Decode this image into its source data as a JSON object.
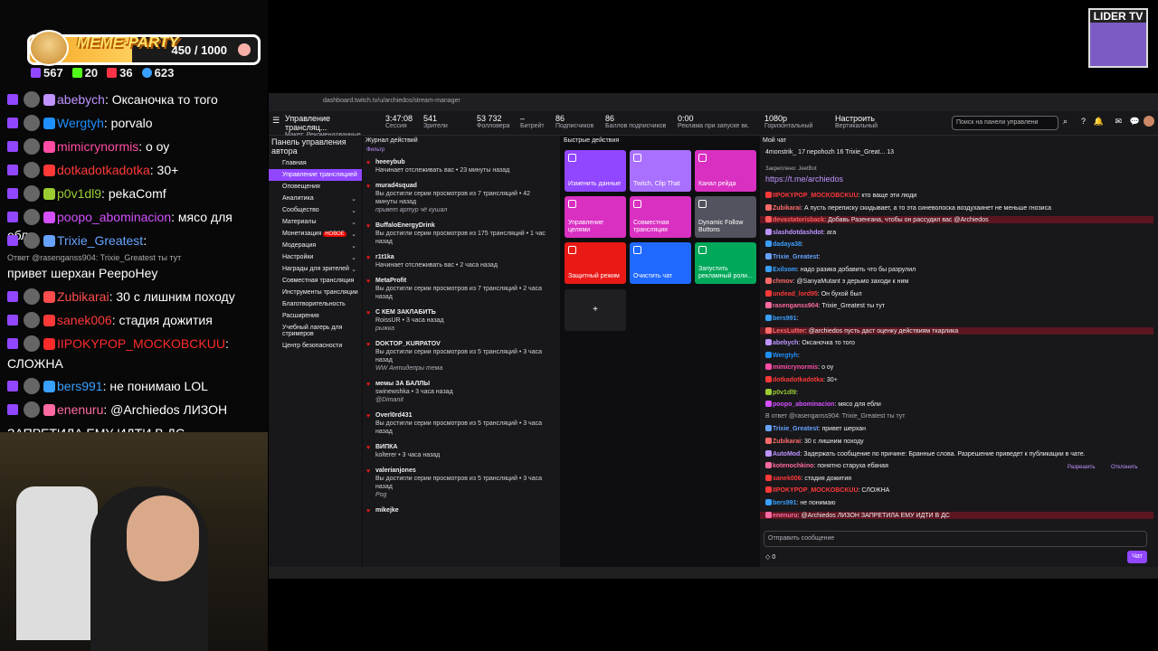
{
  "overlay": {
    "goal_title": "MEME-PARTY",
    "goal_count": "450 / 1000",
    "goal_progress": 0.45,
    "stats": [
      "567",
      "20",
      "36",
      "623"
    ],
    "chat": [
      {
        "user": "abebych",
        "msg": "Оксаночка то того",
        "color": "#bf94ff"
      },
      {
        "user": "Wergtyh",
        "msg": "porvalo",
        "color": "#1e90ff"
      },
      {
        "user": "mimicrynormis",
        "msg": "о оу",
        "color": "#ff4da6"
      },
      {
        "user": "dotkadotkadotka",
        "msg": "30+",
        "color": "#ff3838"
      },
      {
        "user": "p0v1dl9",
        "msg": "pekaComf",
        "color": "#9acd32"
      },
      {
        "user": "poopo_abominacion",
        "msg": "мясо для ебли",
        "color": "#d550ff"
      },
      {
        "user": "Trixie_Greatest",
        "msg": "",
        "color": "#66a3ff"
      },
      {
        "reply": "Ответ @rasenganss904: Trixie_Greatest ты тут"
      },
      {
        "plain": "привет шерхан PeepoHey"
      },
      {
        "user": "Zubikarai",
        "msg": "30 с лишним походу",
        "color": "#ff4d4d"
      },
      {
        "user": "sanek006",
        "msg": "стадия дожития",
        "color": "#ff3838"
      },
      {
        "user": "IIPOKYPOP_MOCKOBCKUU",
        "msg": "",
        "color": "#ff2a2a"
      },
      {
        "plain": "СЛОЖНА"
      },
      {
        "user": "bers991",
        "msg": "не понимаю LOL",
        "color": "#3aa0ff"
      },
      {
        "user": "enenuru",
        "msg": "@Archiedos ЛИЗОН",
        "color": "#ff6aa2"
      },
      {
        "plain": "ЗАПРЕТИЛА ЕМУ ИДТИ В ДС"
      }
    ],
    "channel_badge": "LIDER TV"
  },
  "browser": {
    "url": "dashboard.twitch.tv/u/archiedos/stream-manager",
    "page_title": "Управление трансляц...",
    "layout": "Макет: Рекомендованные",
    "stats": [
      {
        "v": "3:47:08",
        "l": "Сессия"
      },
      {
        "v": "541",
        "l": "Зрители"
      },
      {
        "v": "53 732",
        "l": "Фолловера"
      },
      {
        "v": "–",
        "l": "Битрейт"
      },
      {
        "v": "86",
        "l": "Подписчиков"
      },
      {
        "v": "86",
        "l": "Баллов подписчиков"
      },
      {
        "v": "0:00",
        "l": "Реклама при запуске вк."
      },
      {
        "v": "1080p",
        "l": "Горизонтальный"
      },
      {
        "v": "Настроить",
        "l": "Вертикальный"
      }
    ],
    "search_placeholder": "Поиск на панели управлени",
    "sidebar_title": "Панель управления автора",
    "nav": [
      {
        "label": "Главная"
      },
      {
        "label": "Управление трансляцией",
        "active": true
      },
      {
        "label": "Оповещения"
      },
      {
        "label": "Аналитика",
        "arrow": true
      },
      {
        "label": "Сообщество",
        "arrow": true
      },
      {
        "label": "Материалы",
        "arrow": true
      },
      {
        "label": "Монетизация",
        "tag": "НОВОЕ",
        "arrow": true
      },
      {
        "label": "Модерация",
        "arrow": true
      },
      {
        "label": "Настройки",
        "arrow": true
      },
      {
        "label": "Награды для зрителей",
        "arrow": true
      },
      {
        "label": "Совместная трансляция"
      },
      {
        "label": "Инструменты трансляции"
      },
      {
        "label": "Благотворительность"
      },
      {
        "label": "Расширения"
      },
      {
        "label": "Учебный лагерь для стримеров"
      },
      {
        "label": "Центр безопасности"
      }
    ],
    "activity_title": "Журнал действий",
    "activity_filter": "Фильтр",
    "activity": [
      {
        "name": "heeeybub",
        "sub": "Начинает отслеживать вас • 23 минуты назад"
      },
      {
        "name": "murad4squad",
        "sub": "Вы достигли серии просмотров из 7 трансляций • 42 минуты назад",
        "note": "привет артур чё кушал"
      },
      {
        "name": "BuffaloEnergyDrink",
        "sub": "Вы достигли серии просмотров из 175 трансляций • 1 час назад"
      },
      {
        "name": "r1t1ka",
        "sub": "Начинает отслеживать вас • 2 часа назад"
      },
      {
        "name": "MetaProfit",
        "sub": "Вы достигли серии просмотров из 7 трансляций • 2 часа назад"
      },
      {
        "name": "С КЕМ ЗАКЛАБИТЬ",
        "sub": "RoissUR • 3 часа назад",
        "note": "рыжка"
      },
      {
        "name": "DOKTOP_KURPATOV",
        "sub": "Вы достигли серии просмотров из 5 трансляций • 3 часа назад",
        "note": "WW Антидепры тема"
      },
      {
        "name": "мемы ЗА БАЛЛЫ",
        "sub": "swinewshka • 3 часа назад",
        "note": "@Dimanit"
      },
      {
        "name": "Overl0rd431",
        "sub": "Вы достигли серии просмотров из 5 трансляций • 3 часа назад"
      },
      {
        "name": "ВИПКА",
        "sub": "kolterer • 3 часа назад"
      },
      {
        "name": "valerianjones",
        "sub": "Вы достигли серии просмотров из 5 трансляций • 3 часа назад",
        "note": "Pog"
      },
      {
        "name": "mikejke",
        "sub": ""
      }
    ],
    "qa_title": "Быстрые действия",
    "quick": [
      {
        "label": "Изменить данные",
        "color": "#9147ff"
      },
      {
        "label": "Twitch, Clip That",
        "color": "#a970ff"
      },
      {
        "label": "Канал рейда",
        "color": "#d930c2"
      },
      {
        "label": "Управление целями",
        "color": "#d930c2"
      },
      {
        "label": "Совместная трансляция",
        "color": "#d930c2"
      },
      {
        "label": "Dynamic Follow Buttons",
        "color": "#53535f"
      },
      {
        "label": "Защитный режим",
        "color": "#e91916"
      },
      {
        "label": "Очистить чат",
        "color": "#1f69ff"
      },
      {
        "label": "Запустить рекламный роли...",
        "color": "#00a85a"
      }
    ],
    "chat_title": "Мой чат",
    "chat_top": "4monstrik_ 17  nepohozh 16  Trixie_Great... 13",
    "pinned_by": "Закреплено: JeetBot",
    "pinned_link": "https://t.me/archiedos",
    "chat": [
      {
        "u": "IIPOKYPOP_MOCKOBCKUU",
        "m": "кто ваще эти люди",
        "c": "#ff3838"
      },
      {
        "u": "Zubikarai",
        "m": "А пусть переписку скидывает, а то эта синеволоска воздухаинет не меньше гнозиса",
        "c": "#ff6b6b"
      },
      {
        "u": "devastatorisback",
        "m": "Добавь Разенгана, чтобы он рассудил вас @Archiedos",
        "c": "#ff5c5c",
        "hl": true
      },
      {
        "u": "slashdotdashdot",
        "m": "ага",
        "c": "#bf94ff"
      },
      {
        "u": "dadaya38",
        "m": "",
        "c": "#3aa0ff"
      },
      {
        "u": "Trixie_Greatest",
        "m": "",
        "c": "#66a3ff"
      },
      {
        "u": "Exilsom",
        "m": "надо разика добавить что бы разрулил",
        "c": "#3aa0ff"
      },
      {
        "u": "chmov",
        "m": "@SanyaMutant э дерьмо заходи к ним",
        "c": "#ff6b6b"
      },
      {
        "u": "undead_lord95",
        "m": "Он бухой был",
        "c": "#ff3838"
      },
      {
        "u": "rasenganss904",
        "m": "Trixie_Greatest ты тут",
        "c": "#ff6aa2"
      },
      {
        "u": "bers991",
        "m": "",
        "c": "#3aa0ff"
      },
      {
        "u": "LexsLutter",
        "m": "@archiedos пусть даст оценку действиям ткарлика",
        "c": "#ff6b6b",
        "hl": true
      },
      {
        "u": "abebych",
        "m": "Оксаночка то того",
        "c": "#bf94ff"
      },
      {
        "u": "Wergtyh",
        "m": "",
        "c": "#1e90ff"
      },
      {
        "u": "mimicrynormis",
        "m": "о оу",
        "c": "#ff4da6"
      },
      {
        "u": "dotkadotkadotka",
        "m": "30+",
        "c": "#ff3838"
      },
      {
        "u": "p0v1dl9",
        "m": "",
        "c": "#9acd32"
      },
      {
        "u": "poopo_abominacion",
        "m": "мясо для ебли",
        "c": "#d550ff"
      },
      {
        "u": "",
        "m": "В ответ @rasenganss904: Trixie_Greatest ты тут",
        "c": "#adadb8"
      },
      {
        "u": "Trixie_Greatest",
        "m": "привет шерхан",
        "c": "#66a3ff"
      },
      {
        "u": "Zubikarai",
        "m": "30 с лишним походу",
        "c": "#ff6b6b"
      },
      {
        "u": "AutoMod",
        "m": "Задержать сообщение по причине: Бранные слова. Разрешение приведет к публикации в чате.",
        "c": "#bf94ff"
      },
      {
        "u": "kotenochkino",
        "m": "понятно старуха ебаная",
        "c": "#ff6aa2"
      },
      {
        "u": "sanek006",
        "m": "стадия дожития",
        "c": "#ff3838"
      },
      {
        "u": "IIPOKYPOP_MOCKOBCKUU",
        "m": "СЛОЖНА",
        "c": "#ff3838"
      },
      {
        "u": "bers991",
        "m": "не понимаю",
        "c": "#3aa0ff"
      },
      {
        "u": "enenuru",
        "m": "@Archiedos ЛИЗОН ЗАПРЕТИЛА ЕМУ ИДТИ В ДС",
        "c": "#ff6aa2",
        "hl": true
      }
    ],
    "automod_allow": "Разрешить",
    "automod_deny": "Отклонить",
    "chat_placeholder": "Отправить сообщение",
    "chat_points": "0",
    "chat_send": "Чат"
  }
}
